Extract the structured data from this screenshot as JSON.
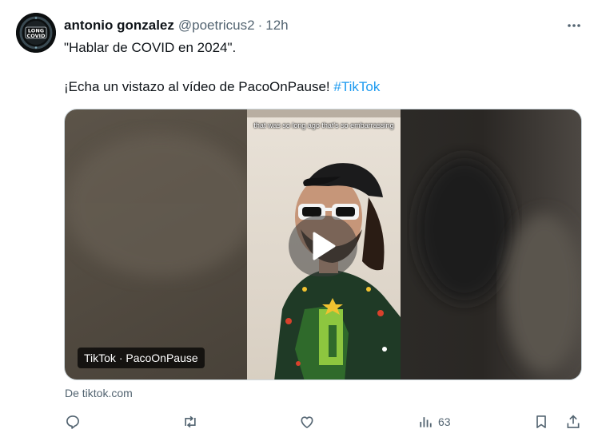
{
  "author": {
    "display_name": "antonio gonzalez",
    "handle": "@poetricus2",
    "separator": "·",
    "time": "12h",
    "avatar": {
      "text_top": "LONG",
      "text_bottom": "COVID",
      "ring_text": "ENCUENTRAME"
    }
  },
  "tweet": {
    "line1": "\"Hablar de COVID en 2024\".",
    "line2_text": "¡Echa un vistazo al vídeo de PacoOnPause! ",
    "hashtag": "#TikTok"
  },
  "media": {
    "caption": "that was so long ago that's so embarrassing",
    "source_label": "TikTok · PacoOnPause",
    "play_icon": "play-icon"
  },
  "link_source": "De tiktok.com",
  "actions": {
    "reply_icon": "reply-icon",
    "repost_icon": "repost-icon",
    "like_icon": "heart-icon",
    "views_icon": "views-icon",
    "views_count": "63",
    "bookmark_icon": "bookmark-icon",
    "share_icon": "share-icon"
  },
  "colors": {
    "text": "#0f1419",
    "secondary": "#536471",
    "link": "#1d9bf0",
    "border": "#cfd9de"
  }
}
